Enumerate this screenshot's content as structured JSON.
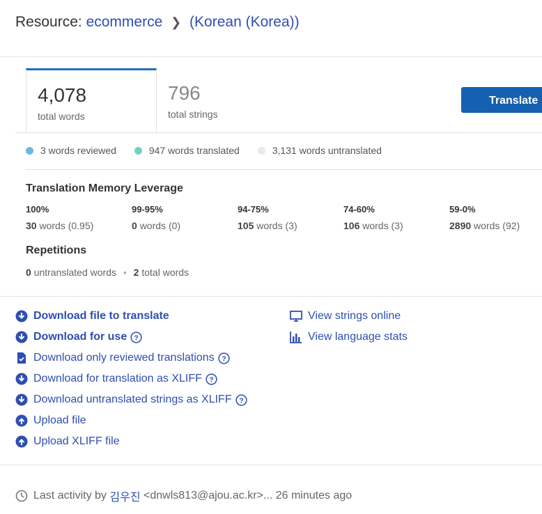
{
  "header": {
    "prefix": "Resource:",
    "resource": "ecommerce",
    "language": "(Korean (Korea))"
  },
  "stats": {
    "words_value": "4,078",
    "words_label": "total words",
    "strings_value": "796",
    "strings_label": "total strings"
  },
  "translate_button": "Translate",
  "legend": [
    {
      "label": "3 words reviewed",
      "color": "#6cb6e3"
    },
    {
      "label": "947 words translated",
      "color": "#6fd3c1"
    },
    {
      "label": "3,131 words untranslated",
      "color": "#e8e8ee"
    }
  ],
  "tm": {
    "title": "Translation Memory Leverage",
    "columns": [
      {
        "range": "100%",
        "count": "30",
        "unit": "words",
        "extra": "(0.95)"
      },
      {
        "range": "99-95%",
        "count": "0",
        "unit": "words",
        "extra": "(0)"
      },
      {
        "range": "94-75%",
        "count": "105",
        "unit": "words",
        "extra": "(3)"
      },
      {
        "range": "74-60%",
        "count": "106",
        "unit": "words",
        "extra": "(3)"
      },
      {
        "range": "59-0%",
        "count": "2890",
        "unit": "words",
        "extra": "(92)"
      }
    ]
  },
  "repetitions": {
    "title": "Repetitions",
    "untranslated_count": "0",
    "untranslated_label": "untranslated words",
    "total_count": "2",
    "total_label": "total words"
  },
  "links_left": [
    {
      "label": "Download file to translate",
      "icon": "download-circle-icon",
      "help": false,
      "bold": true
    },
    {
      "label": "Download for use",
      "icon": "download-circle-icon",
      "help": true,
      "bold": true
    },
    {
      "label": "Download only reviewed translations",
      "icon": "file-check-icon",
      "help": true,
      "bold": false
    },
    {
      "label": "Download for translation as XLIFF",
      "icon": "download-circle-icon",
      "help": true,
      "bold": false
    },
    {
      "label": "Download untranslated strings as XLIFF",
      "icon": "download-circle-icon",
      "help": true,
      "bold": false
    },
    {
      "label": "Upload file",
      "icon": "upload-circle-icon",
      "help": false,
      "bold": false
    },
    {
      "label": "Upload XLIFF file",
      "icon": "upload-circle-icon",
      "help": false,
      "bold": false
    }
  ],
  "links_right": [
    {
      "label": "View strings online",
      "icon": "monitor-icon"
    },
    {
      "label": "View language stats",
      "icon": "bar-chart-icon"
    }
  ],
  "footer": {
    "prefix": "Last activity by",
    "user": "김우진",
    "email": "<dnwls813@ajou.ac.kr>...",
    "time": "26 minutes ago"
  },
  "colors": {
    "link": "#2f4eb1",
    "button": "#1560b0",
    "tab_active_border": "#1d6fb8"
  }
}
